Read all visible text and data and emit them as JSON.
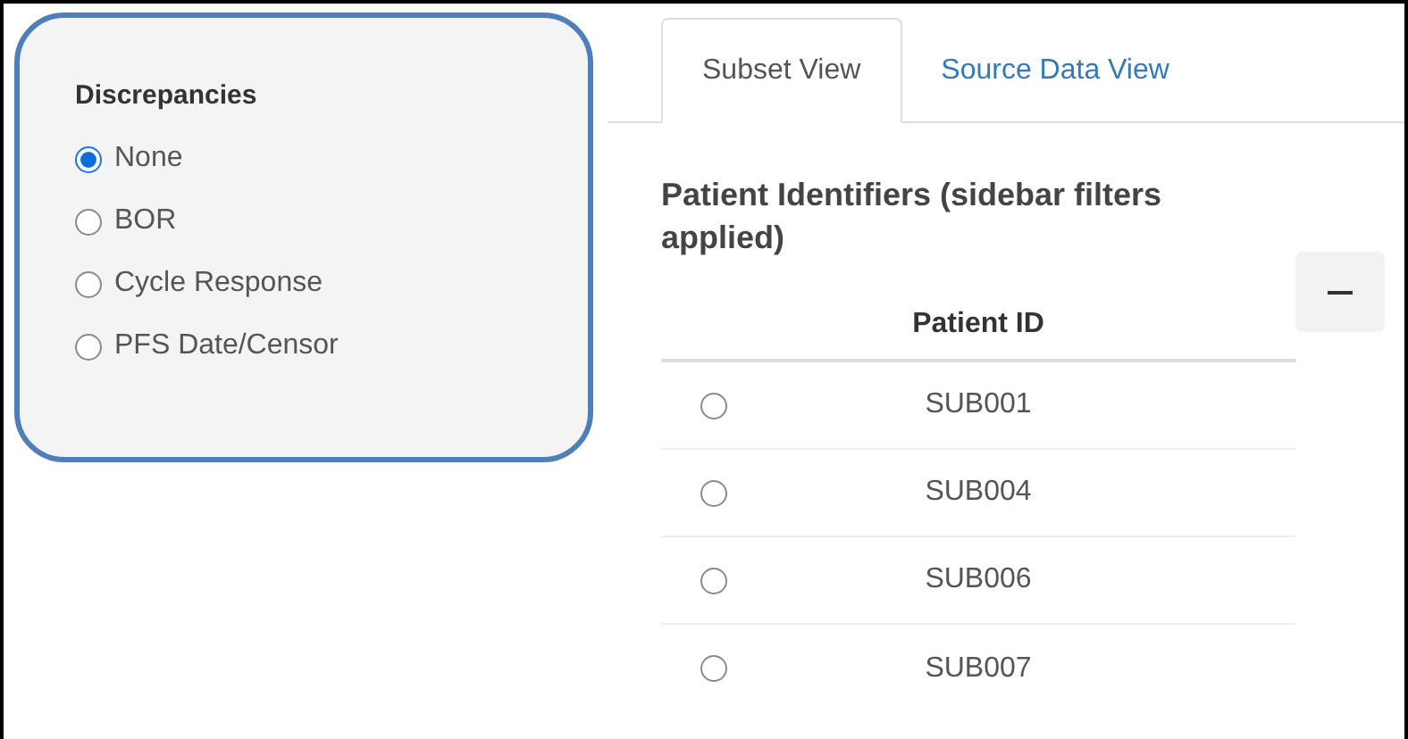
{
  "sidebar": {
    "title": "Discrepancies",
    "options": [
      {
        "label": "None",
        "selected": true
      },
      {
        "label": "BOR",
        "selected": false
      },
      {
        "label": "Cycle Response",
        "selected": false
      },
      {
        "label": "PFS Date/Censor",
        "selected": false
      }
    ]
  },
  "tabs": [
    {
      "label": "Subset View",
      "selected": true
    },
    {
      "label": "Source Data View",
      "selected": false
    }
  ],
  "section_title": "Patient Identifiers (sidebar filters applied)",
  "table": {
    "columns": [
      "Patient ID"
    ],
    "rows": [
      {
        "patient_id": "SUB001",
        "selected": false
      },
      {
        "patient_id": "SUB004",
        "selected": false
      },
      {
        "patient_id": "SUB006",
        "selected": false
      },
      {
        "patient_id": "SUB007",
        "selected": false
      }
    ]
  }
}
